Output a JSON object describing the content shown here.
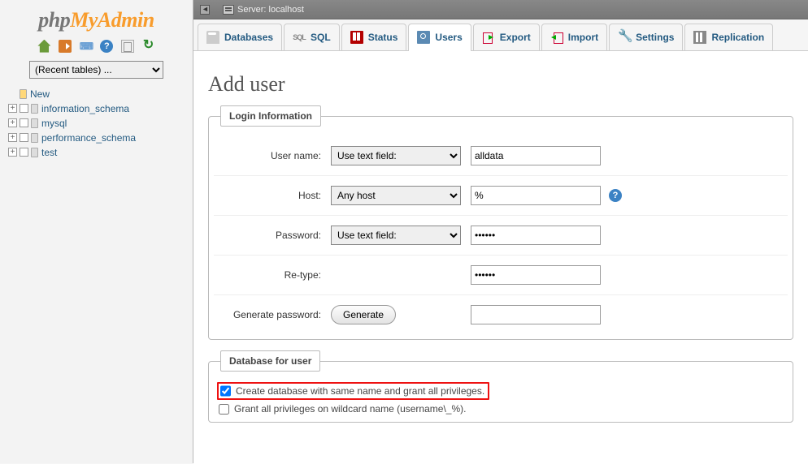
{
  "logo": {
    "part1": "php",
    "part2": "MyAdmin"
  },
  "sidebar": {
    "recent_placeholder": "(Recent tables) ...",
    "nodes": [
      {
        "label": "New"
      },
      {
        "label": "information_schema"
      },
      {
        "label": "mysql"
      },
      {
        "label": "performance_schema"
      },
      {
        "label": "test"
      }
    ]
  },
  "topbar": {
    "server_label": "Server: localhost"
  },
  "tabs": [
    {
      "label": "Databases"
    },
    {
      "label": "SQL"
    },
    {
      "label": "Status"
    },
    {
      "label": "Users"
    },
    {
      "label": "Export"
    },
    {
      "label": "Import"
    },
    {
      "label": "Settings"
    },
    {
      "label": "Replication"
    }
  ],
  "page": {
    "title": "Add user",
    "login_legend": "Login Information",
    "db_legend": "Database for user",
    "fields": {
      "username_label": "User name:",
      "username_mode": "Use text field:",
      "username_value": "alldata",
      "host_label": "Host:",
      "host_mode": "Any host",
      "host_value": "%",
      "password_label": "Password:",
      "password_mode": "Use text field:",
      "password_value": "••••••",
      "retype_label": "Re-type:",
      "retype_value": "••••••",
      "generate_label": "Generate password:",
      "generate_button": "Generate",
      "generate_value": ""
    },
    "db_options": {
      "opt1": "Create database with same name and grant all privileges.",
      "opt2": "Grant all privileges on wildcard name (username\\_%)."
    }
  }
}
